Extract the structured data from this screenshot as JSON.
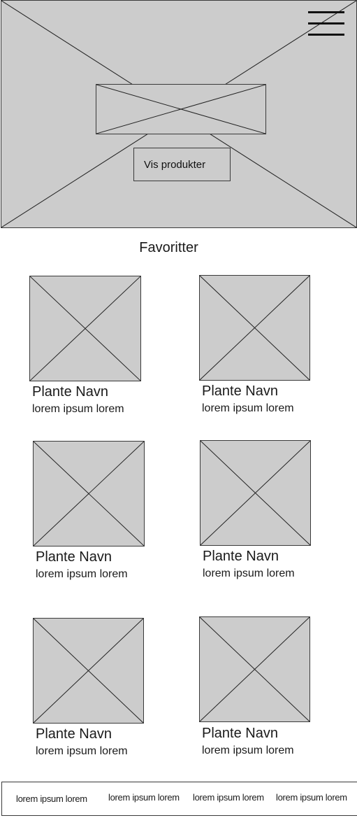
{
  "hero": {
    "button_label": "Vis produkter",
    "menu_icon": "hamburger-menu-icon"
  },
  "favorites": {
    "title": "Favoritter",
    "items": [
      {
        "name": "Plante Navn",
        "description": "lorem ipsum lorem"
      },
      {
        "name": "Plante Navn",
        "description": "lorem ipsum lorem"
      },
      {
        "name": "Plante Navn",
        "description": "lorem ipsum lorem"
      },
      {
        "name": "Plante Navn",
        "description": "lorem ipsum lorem"
      },
      {
        "name": "Plante Navn",
        "description": "lorem ipsum lorem"
      },
      {
        "name": "Plante Navn",
        "description": "lorem ipsum lorem"
      }
    ]
  },
  "footer": {
    "links": [
      "lorem ipsum lorem",
      "lorem ipsum lorem",
      "lorem ipsum lorem",
      "lorem ipsum lorem"
    ]
  }
}
